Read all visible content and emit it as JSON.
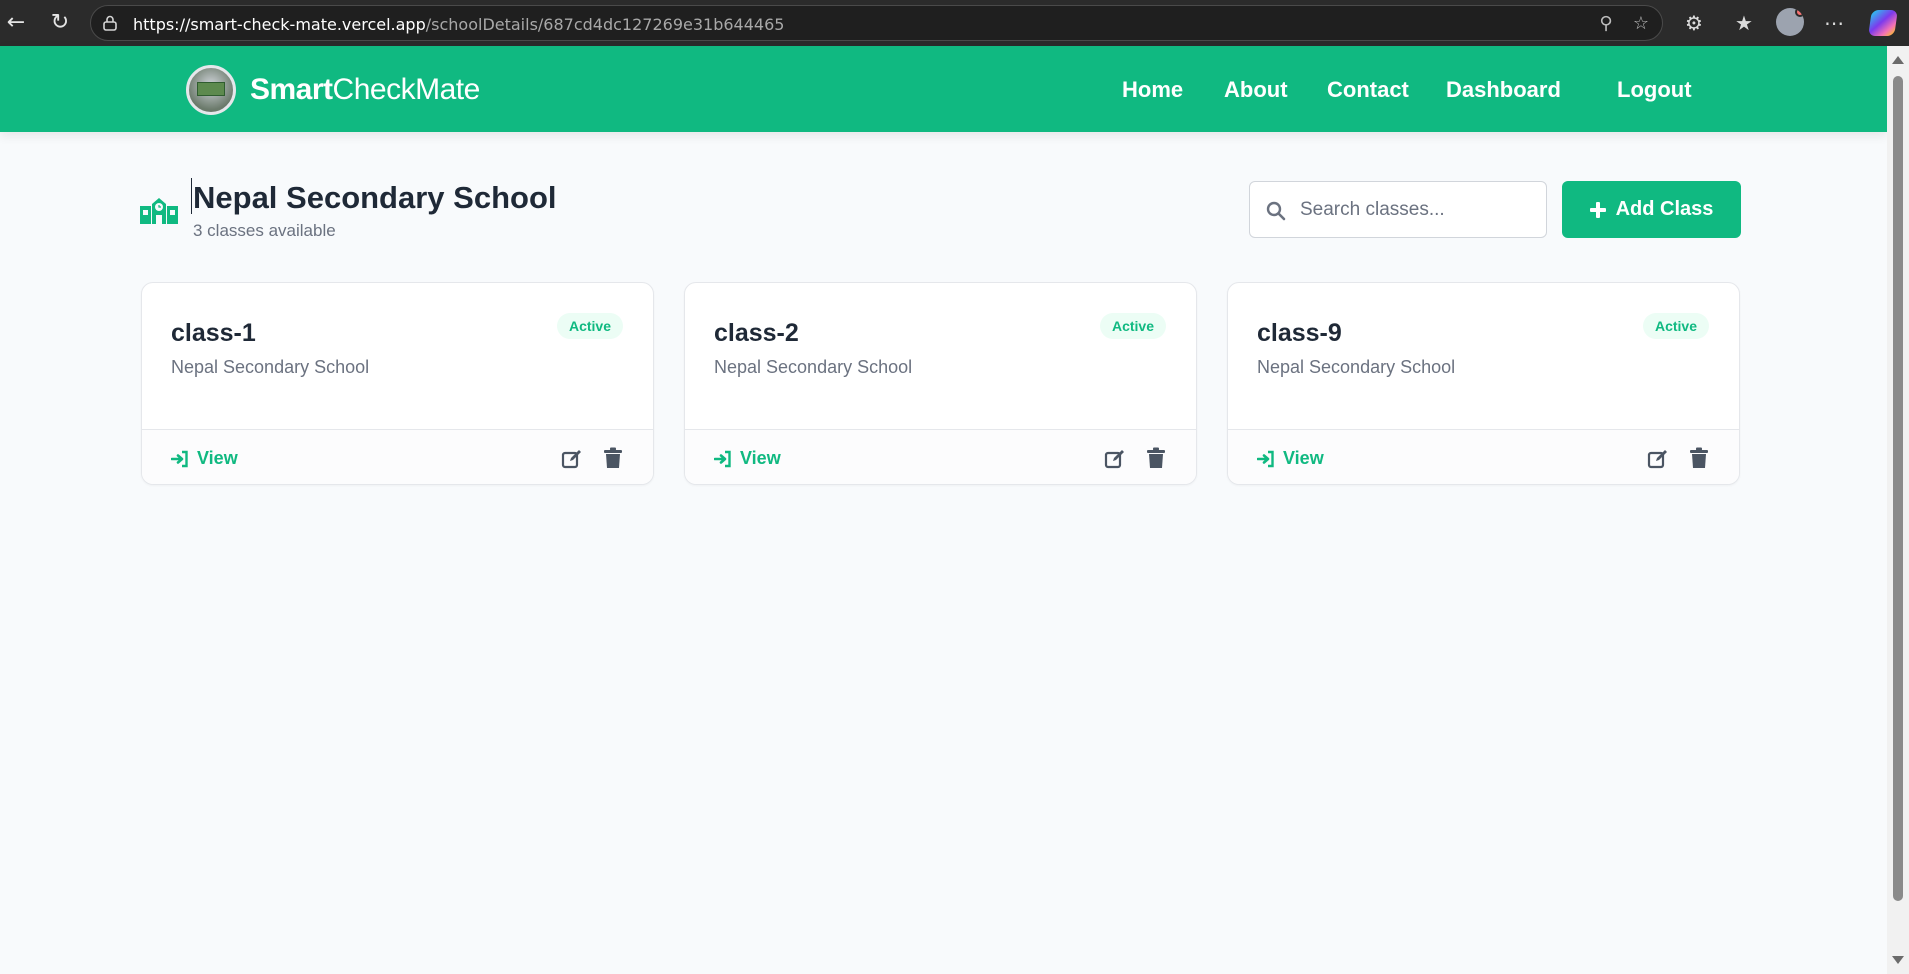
{
  "browser": {
    "url_host": "https://smart-check-mate.vercel.app",
    "url_path": "/schoolDetails/687cd4dc127269e31b644465"
  },
  "header": {
    "brand_bold": "Smart",
    "brand_light": "CheckMate",
    "nav": [
      "Home",
      "About",
      "Contact",
      "Dashboard",
      "Logout"
    ],
    "accent_color": "#10b981"
  },
  "school": {
    "name": "Nepal Secondary School",
    "count_text": "3 classes available"
  },
  "search": {
    "placeholder": "Search classes..."
  },
  "add_button": {
    "label": "Add Class"
  },
  "classes": [
    {
      "name": "class-1",
      "school": "Nepal Secondary School",
      "status": "Active",
      "view_label": "View"
    },
    {
      "name": "class-2",
      "school": "Nepal Secondary School",
      "status": "Active",
      "view_label": "View"
    },
    {
      "name": "class-9",
      "school": "Nepal Secondary School",
      "status": "Active",
      "view_label": "View"
    }
  ]
}
